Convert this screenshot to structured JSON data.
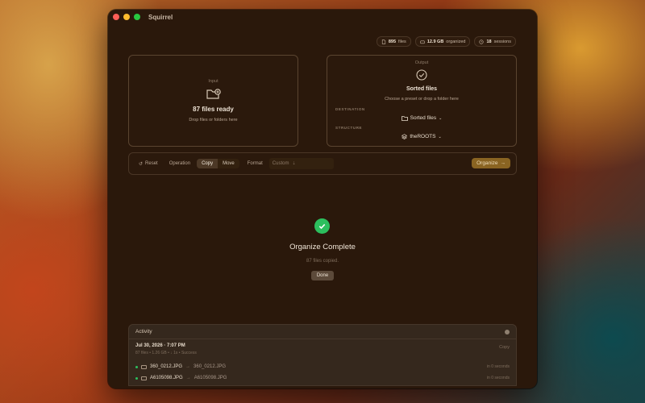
{
  "app": {
    "title": "Squirrel"
  },
  "stats": [
    {
      "icon": "file-icon",
      "value": "895",
      "label": "files"
    },
    {
      "icon": "drive-icon",
      "value": "12.9 GB",
      "label": "organized"
    },
    {
      "icon": "clock-icon",
      "value": "18",
      "label": "sessions"
    }
  ],
  "input": {
    "label": "Input",
    "title": "87 files ready",
    "hint": "Drop files or folders here"
  },
  "output": {
    "label": "Output",
    "title": "Sorted files",
    "hint": "Choose a preset or drop a folder here",
    "destination_label": "DESTINATION",
    "destination_value": "Sorted files",
    "structure_label": "STRUCTURE",
    "structure_value": "theROOTS"
  },
  "toolbar": {
    "reset_label": "Reset",
    "operation_label": "Operation",
    "op_copy": "Copy",
    "op_move": "Move",
    "op_selected": "Copy",
    "format_label": "Format",
    "format_value": "Custom",
    "organize_label": "Organize"
  },
  "status": {
    "title": "Organize Complete",
    "subtitle": "87 files copied.",
    "done_label": "Done"
  },
  "activity": {
    "title": "Activity",
    "session": {
      "date": "Jul 30, 2026 · 7:07 PM",
      "meta": "87 files • 1.26 GB • ↓ 1s • Success",
      "operation": "Copy"
    },
    "files": [
      {
        "src": "360_0212.JPG",
        "dst": "360_0212.JPG",
        "time": "in 0 seconds"
      },
      {
        "src": "A6105098.JPG",
        "dst": "A6105098.JPG",
        "time": "in 0 seconds"
      }
    ]
  },
  "colors": {
    "accent": "#8a6422",
    "success": "#2cbf5e",
    "window_bg": "#2a180b"
  }
}
